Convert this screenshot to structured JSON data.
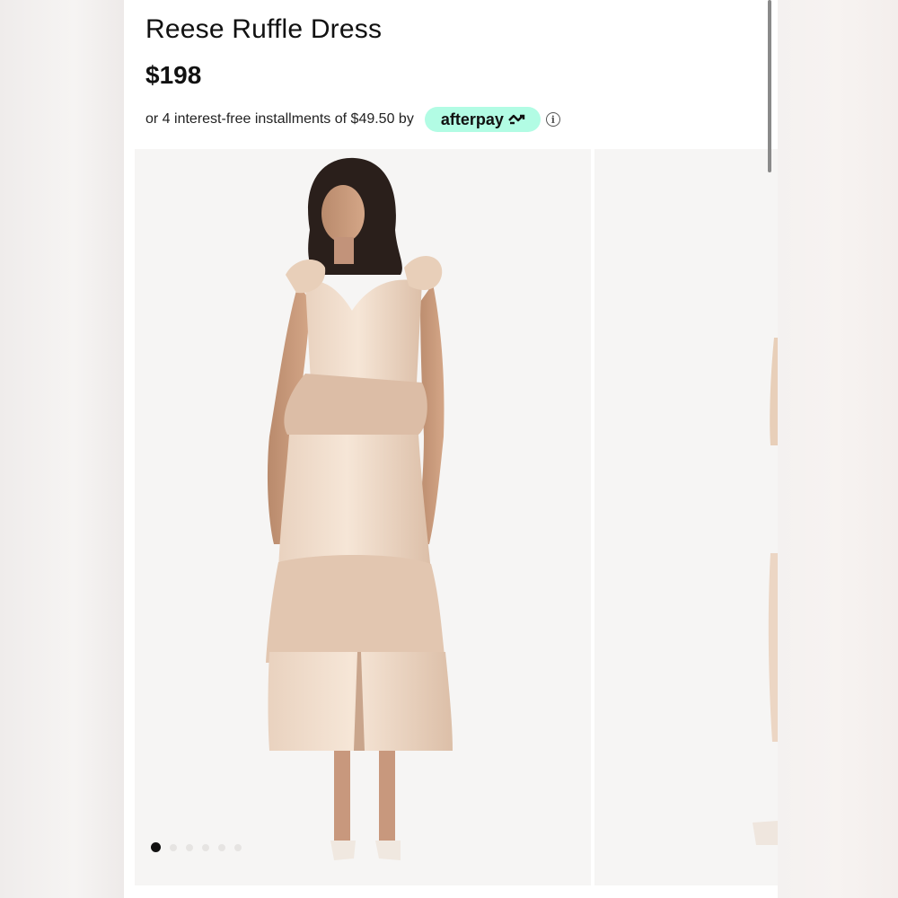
{
  "product": {
    "title": "Reese Ruffle Dress",
    "price": "$198"
  },
  "payment": {
    "installment_text": "or 4 interest-free installments of $49.50 by",
    "provider": "afterpay",
    "provider_color": "#b2fce4",
    "info_symbol": "i"
  },
  "gallery": {
    "image_count": 6,
    "active_index": 0,
    "subject": "woman wearing champagne satin tiered ruffle midi dress"
  },
  "colors": {
    "dress": "#ecd6c4",
    "background": "#ffffff"
  }
}
